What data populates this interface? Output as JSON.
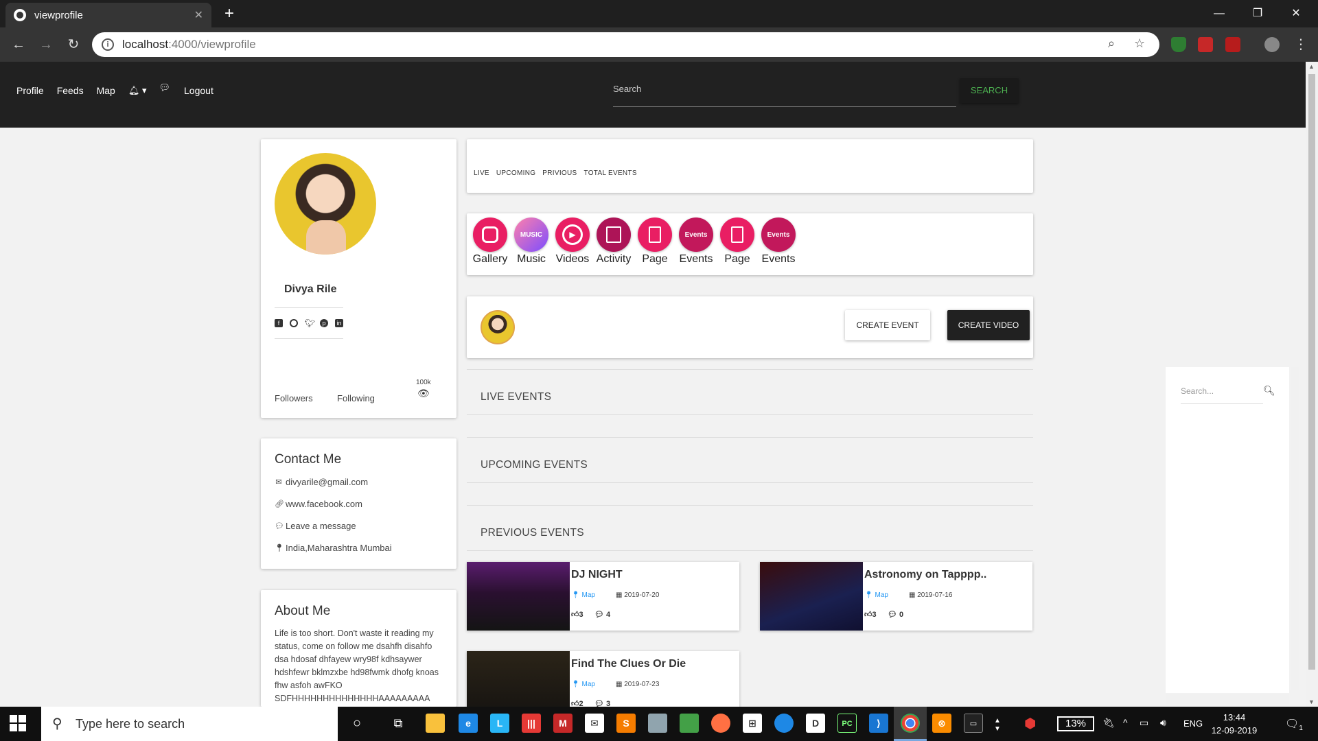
{
  "browser": {
    "tab_title": "viewprofile",
    "url_host": "localhost",
    "url_path": ":4000/viewprofile"
  },
  "site_header": {
    "nav": [
      "Profile",
      "Feeds",
      "Map",
      "Logout"
    ],
    "search_placeholder": "Search",
    "search_button": "SEARCH"
  },
  "profile": {
    "name": "Divya Rile",
    "followers_label": "Followers",
    "following_label": "Following",
    "views": "100k",
    "social_icons": [
      "facebook-icon",
      "instagram-icon",
      "twitter-icon",
      "pinterest-icon",
      "linkedin-icon"
    ]
  },
  "contact": {
    "title": "Contact Me",
    "email": "divyarile@gmail.com",
    "website": "www.facebook.com",
    "message": "Leave a message",
    "location": "India,Maharashtra Mumbai"
  },
  "about": {
    "title": "About Me",
    "text": "Life is too short. Don't waste it reading my status, come on follow me dsahfh disahfo dsa hdosaf dhfayew wry98f kdhsaywer hdshfewr bklmzxbe hd98fwmk dhofg knoas fhw asfoh awFKO SDFHHHHHHHHHHHHHHAAAAAAAAA"
  },
  "event_tabs": [
    "LIVE",
    "UPCOMING",
    "PRIVIOUS",
    "TOTAL EVENTS"
  ],
  "icon_menu": [
    {
      "label": "Gallery",
      "icon": "instagram-icon",
      "color": "#e91e63"
    },
    {
      "label": "Music",
      "icon": "apple-music-icon",
      "badge": "MUSIC",
      "color": "#f06292"
    },
    {
      "label": "Videos",
      "icon": "play-icon",
      "color": "#e91e63"
    },
    {
      "label": "Activity",
      "icon": "activity-icon",
      "color": "#ad1457"
    },
    {
      "label": "Page",
      "icon": "page-icon",
      "color": "#e91e63"
    },
    {
      "label": "Events",
      "icon": "events-icon",
      "badge": "Events",
      "color": "#c2185b"
    },
    {
      "label": "Page",
      "icon": "page-icon",
      "color": "#e91e63"
    },
    {
      "label": "Events",
      "icon": "events-icon",
      "badge": "Events",
      "color": "#c2185b"
    }
  ],
  "actions": {
    "create_event": "CREATE EVENT",
    "create_video": "CREATE VIDEO"
  },
  "sections": {
    "live": "LIVE EVENTS",
    "upcoming": "UPCOMING EVENTS",
    "previous": "PREVIOUS EVENTS"
  },
  "previous_events": [
    {
      "title": "DJ NIGHT",
      "map_label": "Map",
      "date": "2019-07-20",
      "likes": "3",
      "comments": "4"
    },
    {
      "title": "Astronomy on Tapppp..",
      "map_label": "Map",
      "date": "2019-07-16",
      "likes": "3",
      "comments": "0"
    },
    {
      "title": "Find The Clues Or Die",
      "map_label": "Map",
      "date": "2019-07-23",
      "likes": "2",
      "comments": "3"
    }
  ],
  "side_search": {
    "placeholder": "Search..."
  },
  "taskbar": {
    "search_placeholder": "Type here to search",
    "battery": "13%",
    "language": "ENG",
    "time": "13:44",
    "date": "12-09-2019",
    "notifications": "1"
  }
}
